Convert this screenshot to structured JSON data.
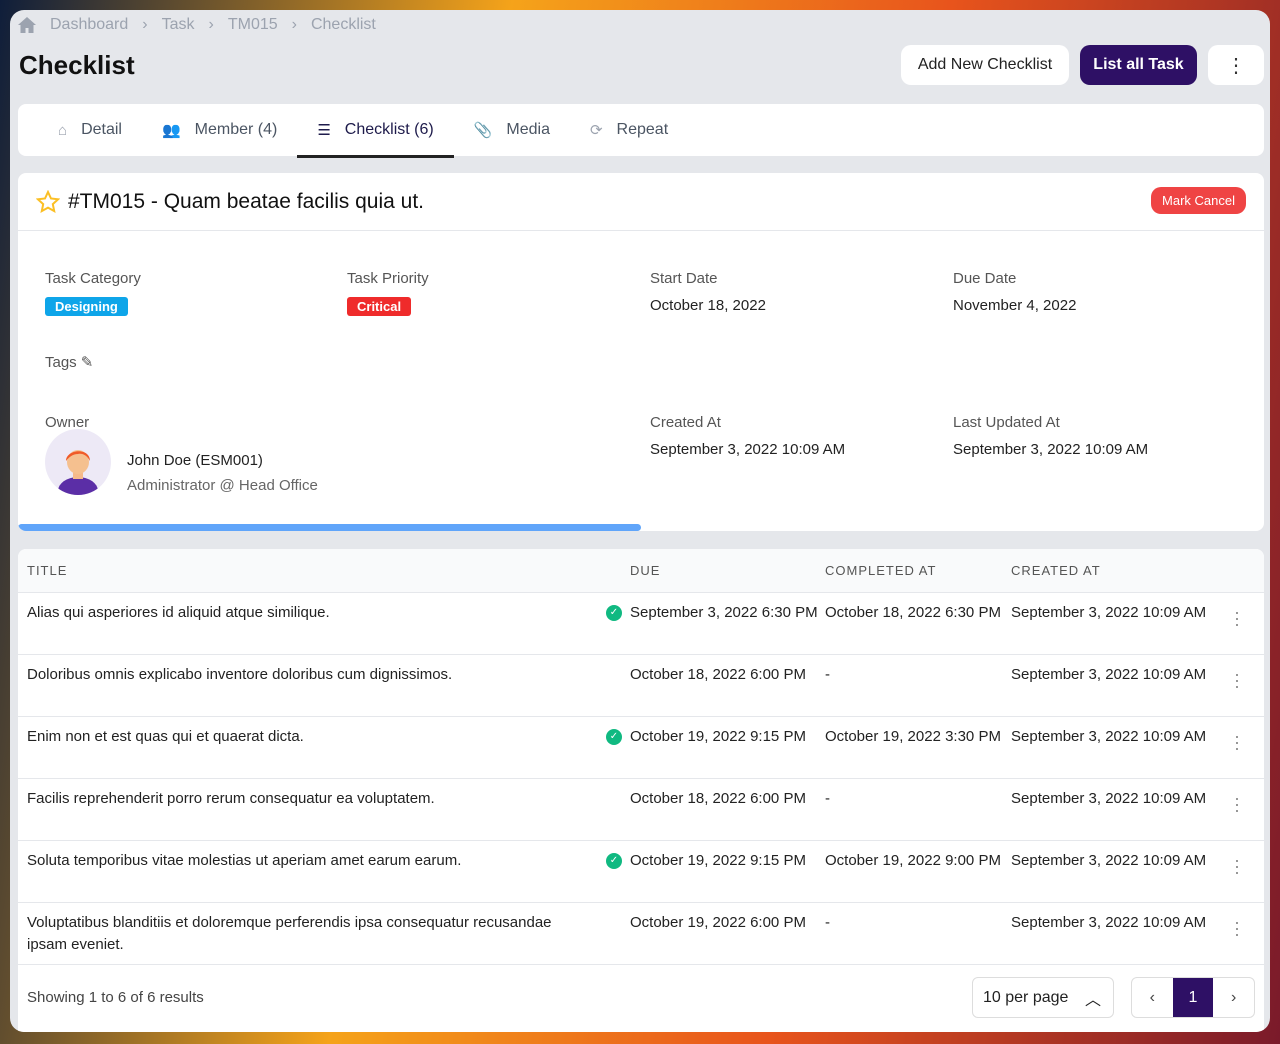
{
  "breadcrumb": [
    "Dashboard",
    "Task",
    "TM015",
    "Checklist"
  ],
  "page_title": "Checklist",
  "actions": {
    "add": "Add New Checklist",
    "list": "List all Task",
    "more": "⋮"
  },
  "tabs": [
    {
      "label": "Detail",
      "icon": "home-icon"
    },
    {
      "label": "Member (4)",
      "icon": "users-icon"
    },
    {
      "label": "Checklist (6)",
      "icon": "list-icon",
      "active": true
    },
    {
      "label": "Media",
      "icon": "paperclip-icon"
    },
    {
      "label": "Repeat",
      "icon": "repeat-icon"
    }
  ],
  "task": {
    "title": "#TM015 - Quam beatae facilis quia ut.",
    "mark_cancel": "Mark Cancel",
    "category_label": "Task Category",
    "category": "Designing",
    "category_color": "#0ea5e9",
    "priority_label": "Task Priority",
    "priority": "Critical",
    "priority_color": "#ef2b2b",
    "start_label": "Start Date",
    "start": "October 18, 2022",
    "due_label": "Due Date",
    "due": "November 4, 2022",
    "tags_label": "Tags",
    "owner_label": "Owner",
    "owner_name": "John Doe (ESM001)",
    "owner_role": "Administrator @ Head Office",
    "created_label": "Created At",
    "created": "September 3, 2022 10:09 AM",
    "updated_label": "Last Updated At",
    "updated": "September 3, 2022 10:09 AM",
    "progress_percent": 50
  },
  "table": {
    "headers": [
      "TITLE",
      "DUE",
      "COMPLETED AT",
      "CREATED AT"
    ],
    "rows": [
      {
        "title": "Alias qui asperiores id aliquid atque similique.",
        "done": true,
        "due": "September 3, 2022 6:30 PM",
        "completed": "October 18, 2022 6:30 PM",
        "created": "September 3, 2022 10:09 AM"
      },
      {
        "title": "Doloribus omnis explicabo inventore doloribus cum dignissimos.",
        "done": false,
        "due": "October 18, 2022 6:00 PM",
        "completed": "-",
        "created": "September 3, 2022 10:09 AM"
      },
      {
        "title": "Enim non et est quas qui et quaerat dicta.",
        "done": true,
        "due": "October 19, 2022 9:15 PM",
        "completed": "October 19, 2022 3:30 PM",
        "created": "September 3, 2022 10:09 AM"
      },
      {
        "title": "Facilis reprehenderit porro rerum consequatur ea voluptatem.",
        "done": false,
        "due": "October 18, 2022 6:00 PM",
        "completed": "-",
        "created": "September 3, 2022 10:09 AM"
      },
      {
        "title": "Soluta temporibus vitae molestias ut aperiam amet earum earum.",
        "done": true,
        "due": "October 19, 2022 9:15 PM",
        "completed": "October 19, 2022 9:00 PM",
        "created": "September 3, 2022 10:09 AM"
      },
      {
        "title": "Voluptatibus blanditiis et doloremque perferendis ipsa consequatur recusandae ipsam eveniet.",
        "done": false,
        "due": "October 19, 2022 6:00 PM",
        "completed": "-",
        "created": "September 3, 2022 10:09 AM"
      }
    ]
  },
  "footer": {
    "summary": "Showing 1 to 6 of 6 results",
    "per_page": "10 per page",
    "current_page": "1"
  }
}
